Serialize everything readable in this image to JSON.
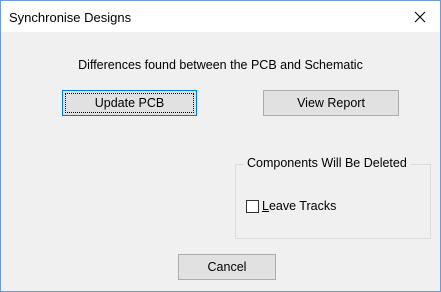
{
  "window": {
    "title": "Synchronise Designs",
    "close_glyph": "✕"
  },
  "message": "Differences found between the PCB and Schematic",
  "buttons": {
    "update_pcb": "Update PCB",
    "view_report": "View Report",
    "cancel": "Cancel"
  },
  "group": {
    "legend": "Components Will Be Deleted",
    "checkbox": {
      "label_mnemonic": "L",
      "label_rest": "eave Tracks",
      "checked": false
    }
  },
  "colors": {
    "window_border": "#6d9bd6",
    "dialog_bg": "#f0f0f0",
    "button_bg": "#e1e1e1",
    "default_button_border": "#0078d7"
  }
}
